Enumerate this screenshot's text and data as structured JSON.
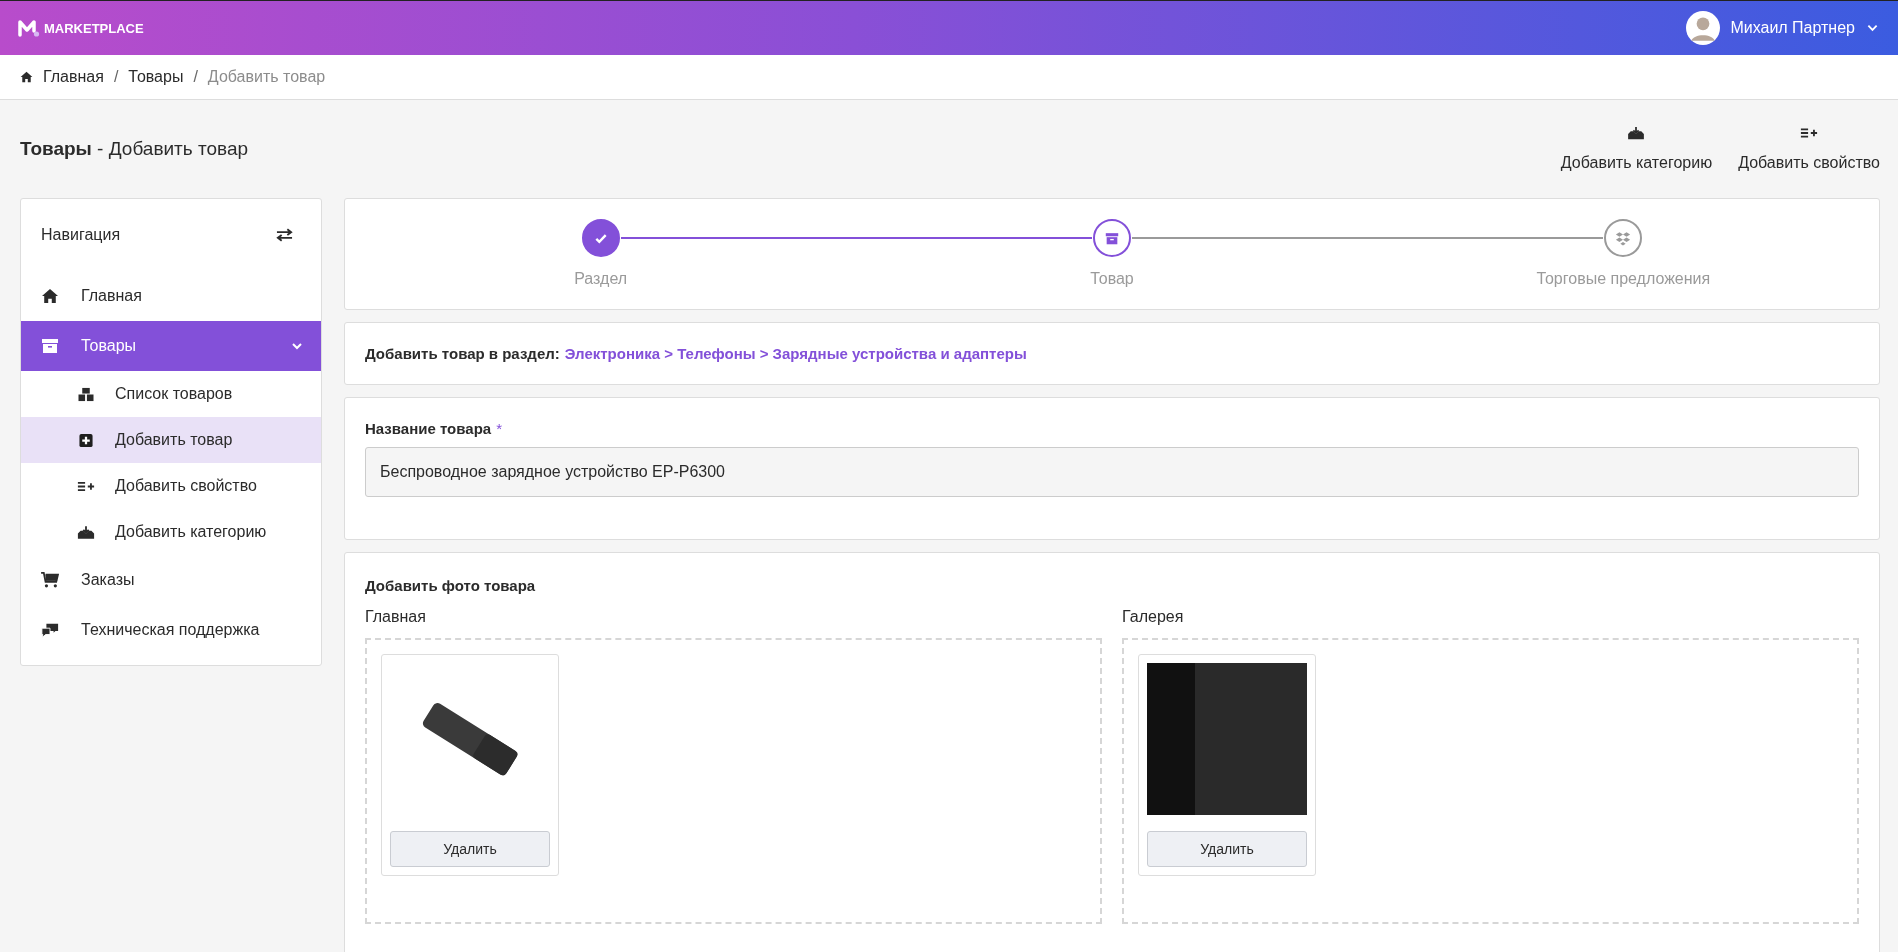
{
  "header": {
    "logo": "MARKETPLACE",
    "user": "Михаил Партнер"
  },
  "breadcrumb": [
    {
      "label": "Главная",
      "current": false
    },
    {
      "separator": "/",
      "label": "Товары",
      "current": false
    },
    {
      "separator": "/",
      "label": "Добавить товар",
      "current": true
    }
  ],
  "page_title": "**Товары** - Добавить товар",
  "actions": [
    {
      "label": "Добавить категорию"
    },
    {
      "label": "Добавить свойство"
    }
  ],
  "sidebar": {
    "title": "Навигация",
    "items": [
      {
        "label": "Главная",
        "selected": false
      },
      {
        "label": "Товары",
        "selected": true,
        "expanded": true,
        "children": [
          {
            "label": "Список товаров",
            "selected": false
          },
          {
            "label": "Добавить товар",
            "selected": true
          },
          {
            "label": "Добавить свойство",
            "selected": false
          },
          {
            "label": "Добавить категорию",
            "selected": false
          }
        ]
      },
      {
        "label": "Заказы",
        "selected": false
      },
      {
        "label": "Техническая поддержка",
        "selected": false
      }
    ]
  },
  "stepper": [
    {
      "label": "Раздел",
      "done": true,
      "current": false
    },
    {
      "label": "Товар",
      "done": false,
      "current": true
    },
    {
      "label": "Торговые предложения",
      "done": false,
      "current": false
    }
  ],
  "section": {
    "label": "Добавить товар в раздел:",
    "path": "Электроника > Телефоны > Зарядные устройства и адаптеры"
  },
  "name_field": {
    "label": "Название товара",
    "required_mark": "*",
    "value": "Беспроводное зарядное устройство EP-P6300"
  },
  "photos": {
    "title": "Добавить фото товара",
    "groups": [
      {
        "label": "Главная",
        "images": [
          {
            "kind": "pad",
            "button": "Удалить"
          }
        ]
      },
      {
        "label": "Галерея",
        "images": [
          {
            "kind": "photo",
            "button": "Удалить"
          }
        ]
      }
    ]
  }
}
